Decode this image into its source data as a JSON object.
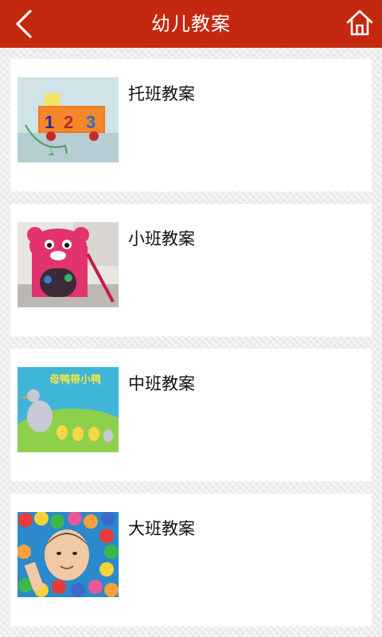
{
  "header": {
    "title": "幼儿教案",
    "back_icon": "chevron-left-icon",
    "home_icon": "home-icon",
    "bg_color": "#c4280f"
  },
  "categories": [
    {
      "label": "托班教案",
      "thumbnail": "toy-truck-123-photo"
    },
    {
      "label": "小班教案",
      "thumbnail": "bear-box-toy-photo"
    },
    {
      "label": "中班教案",
      "thumbnail": "mother-duck-ducklings-cartoon"
    },
    {
      "label": "大班教案",
      "thumbnail": "child-in-ball-pit-photo"
    }
  ]
}
